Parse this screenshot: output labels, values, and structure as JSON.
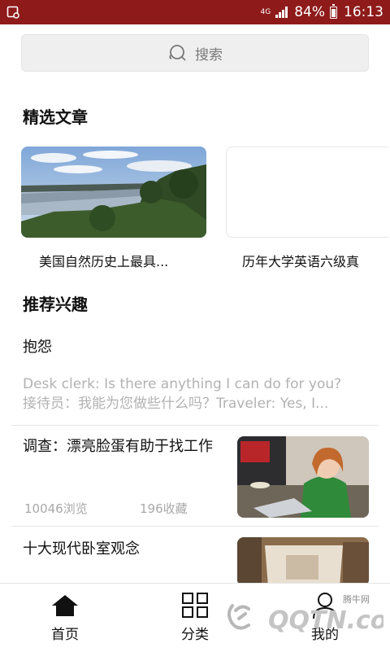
{
  "status_bar": {
    "network": "4G",
    "battery": "84%",
    "time": "16:13"
  },
  "search": {
    "placeholder": "搜索"
  },
  "featured": {
    "title": "精选文章",
    "articles": [
      {
        "caption": "美国自然历史上最具..."
      },
      {
        "caption": "历年大学英语六级真"
      }
    ]
  },
  "recommend": {
    "title": "推荐兴趣",
    "items": [
      {
        "title": "抱怨",
        "excerpt_line1": "Desk clerk: Is there anything I can do for you?",
        "excerpt_line2": "接待员：我能为您做些什么吗？Traveler: Yes, I..."
      },
      {
        "title": "调查：漂亮脸蛋有助于找工作",
        "views": "10046浏览",
        "favorites": "196收藏"
      },
      {
        "title": "十大现代卧室观念"
      }
    ]
  },
  "tabbar": {
    "home": "首页",
    "category": "分类",
    "mine": "我的"
  },
  "watermark": {
    "site": "腾牛网",
    "logo": "QQTN.com"
  },
  "colors": {
    "status_bar": "#8e1a1a",
    "text": "#111111",
    "muted": "#b2b2b2"
  },
  "icons": {
    "search": "search-icon",
    "home": "home-icon",
    "category": "grid-icon",
    "mine": "user-icon"
  }
}
